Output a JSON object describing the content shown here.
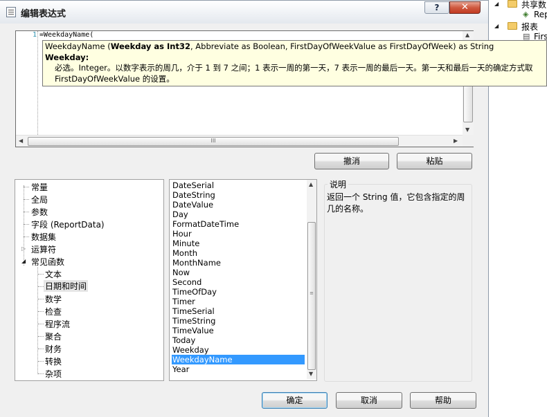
{
  "dialog": {
    "title": "编辑表达式",
    "help_symbol": "?",
    "close_symbol": "✕"
  },
  "editor": {
    "line_number": "1",
    "code": "=WeekdayName(",
    "scroll_grip": "III"
  },
  "tooltip": {
    "sig_name": "WeekdayName (",
    "sig_param_bold": "Weekday as Int32",
    "sig_rest": ", Abbreviate as Boolean, FirstDayOfWeekValue as FirstDayOfWeek) as String",
    "param_name": "Weekday:",
    "desc_line1": "必选。Integer。以数字表示的周几，介于 1 到 7 之间；1 表示一周的第一天，7 表示一周的最后一天。第一天和最后一天的确定方式取",
    "desc_line2": "FirstDayOfWeekValue 的设置。"
  },
  "buttons": {
    "undo": "撤消",
    "paste": "粘贴",
    "ok": "确定",
    "cancel": "取消",
    "help": "帮助"
  },
  "categories": {
    "items": [
      "常量",
      "全局",
      "参数",
      "字段 (ReportData)",
      "数据集",
      "运算符",
      "常见函数"
    ],
    "sub_items": [
      "文本",
      "日期和时间",
      "数学",
      "检查",
      "程序流",
      "聚合",
      "财务",
      "转换",
      "杂项"
    ],
    "selected_sub": "日期和时间"
  },
  "functions": {
    "items": [
      "DateSerial",
      "DateString",
      "DateValue",
      "Day",
      "FormatDateTime",
      "Hour",
      "Minute",
      "Month",
      "MonthName",
      "Now",
      "Second",
      "TimeOfDay",
      "Timer",
      "TimeSerial",
      "TimeString",
      "TimeValue",
      "Today",
      "Weekday",
      "WeekdayName",
      "Year"
    ],
    "selected": "WeekdayName",
    "scroll_grip": "≡"
  },
  "description": {
    "label": "说明",
    "text": "返回一个 String 值，它包含指定的周几的名称。"
  },
  "side_panel": {
    "items": [
      "共享数",
      "Rep",
      "报表",
      "Firs"
    ]
  },
  "colors": {
    "selection": "#3399ff",
    "tooltip_bg": "#ffffe1",
    "close_button": "#c23b22"
  }
}
